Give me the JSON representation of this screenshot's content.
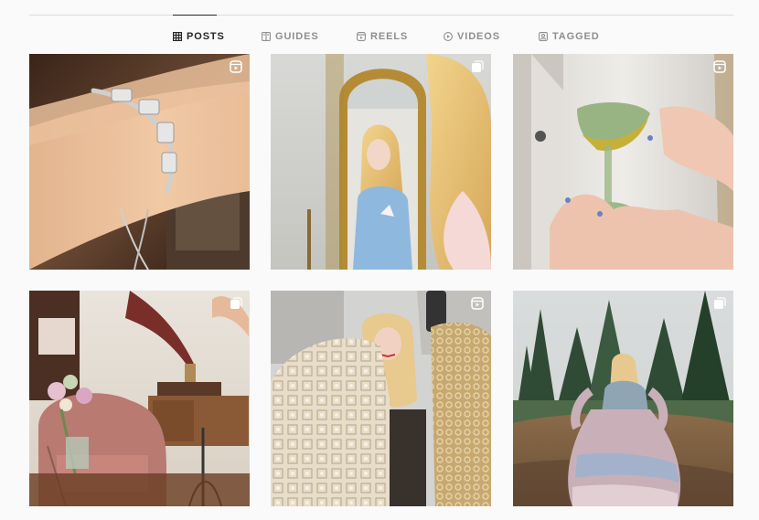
{
  "tabs": [
    {
      "id": "posts",
      "label": "POSTS",
      "icon": "grid-icon",
      "active": true
    },
    {
      "id": "guides",
      "label": "GUIDES",
      "icon": "guides-icon",
      "active": false
    },
    {
      "id": "reels",
      "label": "REELS",
      "icon": "reels-icon",
      "active": false
    },
    {
      "id": "videos",
      "label": "VIDEOS",
      "icon": "play-icon",
      "active": false
    },
    {
      "id": "tagged",
      "label": "TAGGED",
      "icon": "tagged-icon",
      "active": false
    }
  ],
  "posts": [
    {
      "id": "post-bracelet",
      "badge": "reel-icon"
    },
    {
      "id": "post-mirror",
      "badge": "carousel-icon"
    },
    {
      "id": "post-glass",
      "badge": "reel-icon"
    },
    {
      "id": "post-armchair-room",
      "badge": "carousel-icon"
    },
    {
      "id": "post-lace-fabrics",
      "badge": "reel-icon"
    },
    {
      "id": "post-forest-dress",
      "badge": "carousel-icon"
    }
  ],
  "colors": {
    "background": "#fafafa",
    "divider": "#dbdbdb",
    "tab_active": "#262626",
    "tab_inactive": "#8e8e8e"
  }
}
